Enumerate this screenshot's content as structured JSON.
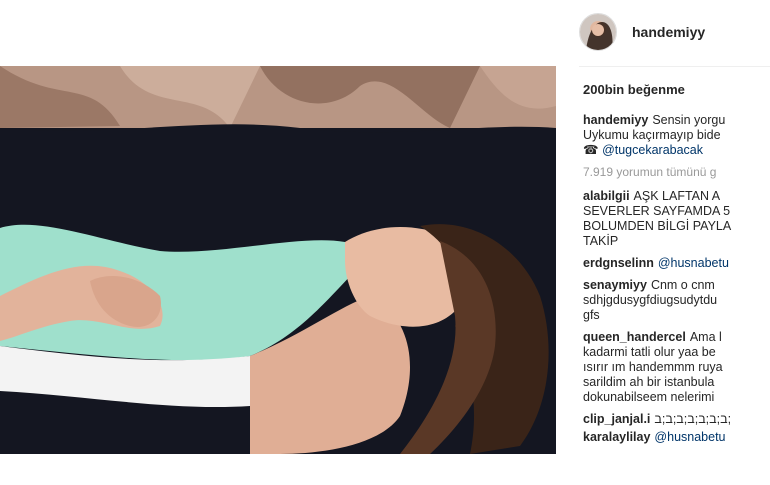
{
  "post": {
    "username": "handemiyy",
    "likes": "200bin beğenme",
    "caption": {
      "user": "handemiyy",
      "line1": "Sensin yorgu",
      "line2": "Uykumu kaçırmayıp bide",
      "mention": "@tugcekarabacak"
    },
    "view_all": "7.919 yorumun tümünü g",
    "comments": [
      {
        "user": "alabilgii",
        "lines": [
          "AŞK LAFTAN A",
          "SEVERLER SAYFAMDA 5",
          "BOLUMDEN BİLGİ PAYLA",
          "TAKİP"
        ]
      },
      {
        "user": "erdgnselinn",
        "mention": "@husnabetu"
      },
      {
        "user": "senaymiyy",
        "lines": [
          "Cnm o cnm",
          "sdhjgdusygfdiugsudytdu",
          "gfs"
        ]
      },
      {
        "user": "queen_handercel",
        "lines": [
          "Ama l",
          "kadarmi tatli olur yaa be",
          "ısırır ım handemmm ruya",
          "sarildim ah bir istanbula",
          "dokunabilseem nelerimi"
        ]
      },
      {
        "user": "clip_janjal.i",
        "lines": [
          "ב;ב;ב;ב;ב;ב;ב;"
        ]
      },
      {
        "user": "karalaylilay",
        "mention": "@husnabetu"
      }
    ]
  }
}
